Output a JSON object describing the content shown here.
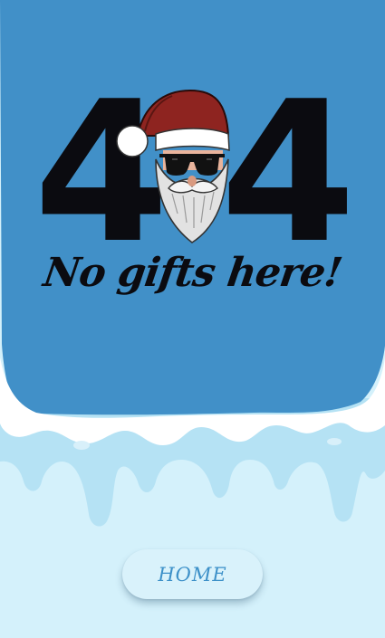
{
  "error": {
    "code_left": "4",
    "code_right": "4",
    "message": "No gifts here!"
  },
  "actions": {
    "home_label": "HOME"
  },
  "illustration": {
    "character": "santa-with-sunglasses"
  },
  "colors": {
    "sky": "#4190c8",
    "snow": "#ffffff",
    "ice": "#b5e2f4",
    "ground": "#d4f1fb",
    "text": "#0b0b10",
    "button_text": "#3c90c8",
    "hat": "#8e2420"
  }
}
